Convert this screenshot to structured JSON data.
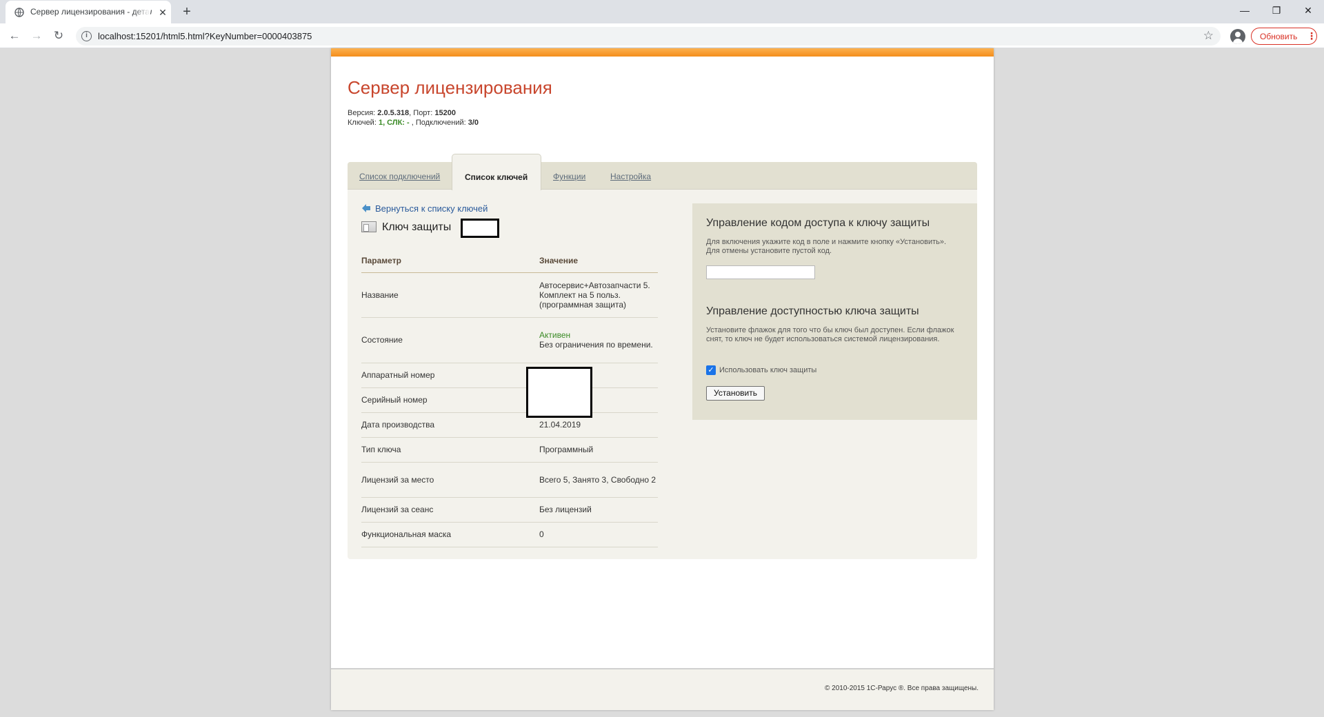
{
  "browser": {
    "tab_title": "Сервер лицензирования - детали ключа",
    "new_tab": "+",
    "url": "localhost:15201/html5.html?KeyNumber=0000403875",
    "update_label": "Обновить",
    "menu_glyph": "⋮",
    "close_glyph": "✕",
    "minimize_glyph": "—",
    "restore_glyph": "❐",
    "back_glyph": "←",
    "forward_glyph": "→",
    "reload_glyph": "↻",
    "star_glyph": "☆",
    "info_glyph": "i"
  },
  "header": {
    "title": "Сервер лицензирования",
    "version_label": "Версия: ",
    "version": "2.0.5.318",
    "port_label": ", Порт: ",
    "port": "15200",
    "keys_label": "Ключей: ",
    "keys_value": "1, СЛК: - ",
    "connections_label": ", Подключений: ",
    "connections": "3/0"
  },
  "tabs": [
    {
      "label": "Список подключений",
      "active": false
    },
    {
      "label": "Список ключей",
      "active": true
    },
    {
      "label": "Функции",
      "active": false
    },
    {
      "label": "Настройка",
      "active": false
    }
  ],
  "key_details": {
    "back_link": "Вернуться к списку ключей",
    "heading": "Ключ защиты",
    "columns": [
      "Параметр",
      "Значение"
    ],
    "rows": [
      {
        "name": "Название",
        "value": "Автосервис+Автозапчасти 5. Комплект на 5 польз. (программная защита)"
      },
      {
        "name": "Состояние",
        "status": "Активен",
        "value": "Без ограничения по времени."
      },
      {
        "name": "Аппаратный номер",
        "value": ""
      },
      {
        "name": "Серийный номер",
        "value": ""
      },
      {
        "name": "Дата производства",
        "value": "21.04.2019"
      },
      {
        "name": "Тип ключа",
        "value": "Программный"
      },
      {
        "name": "Лицензий за место",
        "value": "Всего 5, Занято 3, Свободно 2"
      },
      {
        "name": "Лицензий за сеанс",
        "value": "Без лицензий"
      },
      {
        "name": "Функциональная маска",
        "value": "0"
      }
    ]
  },
  "access_code": {
    "heading": "Управление кодом доступа к ключу защиты",
    "description": "Для включения укажите код в поле и нажмите кнопку «Установить». Для отмены установите пустой код.",
    "input_value": ""
  },
  "availability": {
    "heading": "Управление доступностью ключа защиты",
    "description": "Установите флажок для того что бы ключ был доступен. Если флажок снят, то ключ не будет использоваться системой лицензирования.",
    "checkbox_label": "Использовать ключ защиты",
    "checkbox_checked": true,
    "checkbox_glyph": "✓",
    "button_label": "Установить"
  },
  "footer": {
    "copyright": "© 2010-2015 1С-Рарус ®. Все права защищены."
  },
  "colors": {
    "title": "#c8462d",
    "accent_orange": "#f48e1c",
    "status_green": "#3a8a25",
    "link": "#2a5a9b"
  }
}
